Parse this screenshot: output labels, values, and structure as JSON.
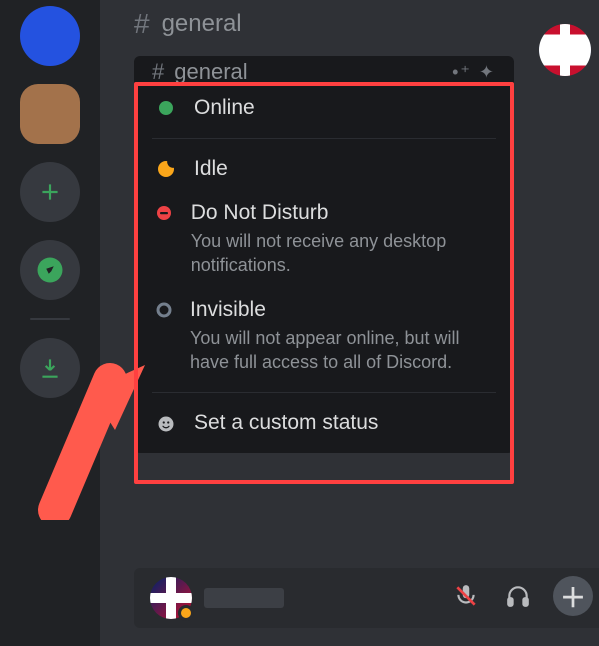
{
  "channel": {
    "name": "general"
  },
  "menu_channel": {
    "name": "general"
  },
  "status": {
    "online": {
      "label": "Online"
    },
    "idle": {
      "label": "Idle"
    },
    "dnd": {
      "label": "Do Not Disturb",
      "desc": "You will not receive any desktop notifications."
    },
    "invisible": {
      "label": "Invisible",
      "desc": "You will not appear online, but will have full access to all of Discord."
    },
    "custom": {
      "label": "Set a custom status"
    }
  },
  "colors": {
    "online": "#3ba55c",
    "idle": "#faa61a",
    "dnd": "#ed4245",
    "invisible": "#747f8d",
    "highlight": "#ff4040"
  }
}
